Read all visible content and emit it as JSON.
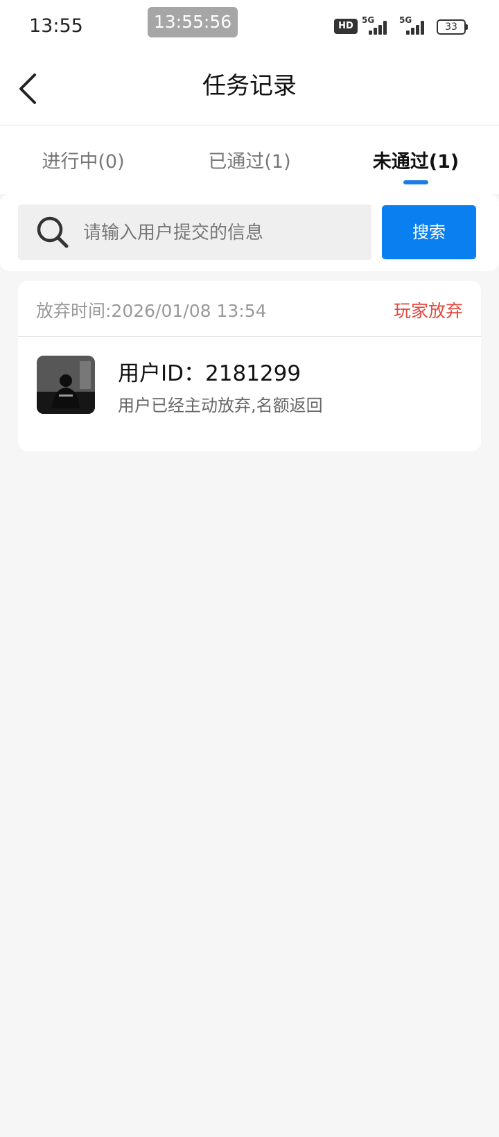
{
  "status_bar": {
    "time": "13:55",
    "recording_time": "13:55:56",
    "hd_label": "HD",
    "network_1": "5G",
    "network_2": "5G",
    "battery": "33"
  },
  "header": {
    "title": "任务记录",
    "back_icon": "chevron-left-icon"
  },
  "tabs": [
    {
      "label": "进行中(0)",
      "active": false
    },
    {
      "label": "已通过(1)",
      "active": false
    },
    {
      "label": "未通过(1)",
      "active": true
    }
  ],
  "search": {
    "placeholder": "请输入用户提交的信息",
    "value": "",
    "button_label": "搜索",
    "icon": "search-icon"
  },
  "records": [
    {
      "time_label": "放弃时间:2026/01/08 13:54",
      "status": "玩家放弃",
      "user_id_label": "用户ID：2181299",
      "description": "用户已经主动放弃,名额返回"
    }
  ],
  "colors": {
    "accent": "#0a7ff0",
    "tab_indicator": "#1a7ee6",
    "status_red": "#e2473c",
    "background": "#f6f6f6"
  }
}
